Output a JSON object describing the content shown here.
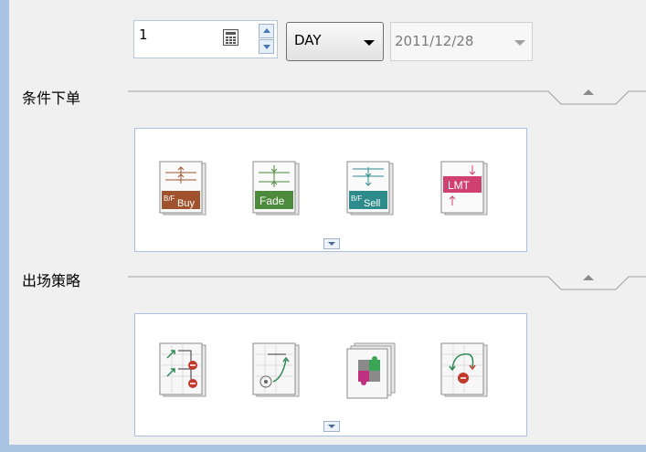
{
  "toolbar": {
    "quantity": "1",
    "period": "DAY",
    "date": "2011/12/28"
  },
  "sections": [
    {
      "title": "条件下单",
      "tools": [
        {
          "name": "bf-buy",
          "label": "B/F",
          "sub": "Buy",
          "color": "#a0522d"
        },
        {
          "name": "fade",
          "label": "Fade",
          "color": "#4c8a3c"
        },
        {
          "name": "bf-sell",
          "label": "B/F",
          "sub": "Sell",
          "color": "#2e8b8b"
        },
        {
          "name": "lmt",
          "label": "LMT",
          "color": "#d04070"
        }
      ]
    },
    {
      "title": "出场策略",
      "tools": [
        {
          "name": "exit-multi-stop",
          "color": "#2e8b57"
        },
        {
          "name": "exit-target",
          "color": "#2e8b57"
        },
        {
          "name": "exit-puzzle",
          "color": "#c03080"
        },
        {
          "name": "exit-reverse",
          "color": "#c0392b"
        }
      ]
    }
  ],
  "colors": {
    "frame": "#a9c4e2",
    "panel_border": "#a8c0de",
    "background": "#f0f0f0"
  }
}
